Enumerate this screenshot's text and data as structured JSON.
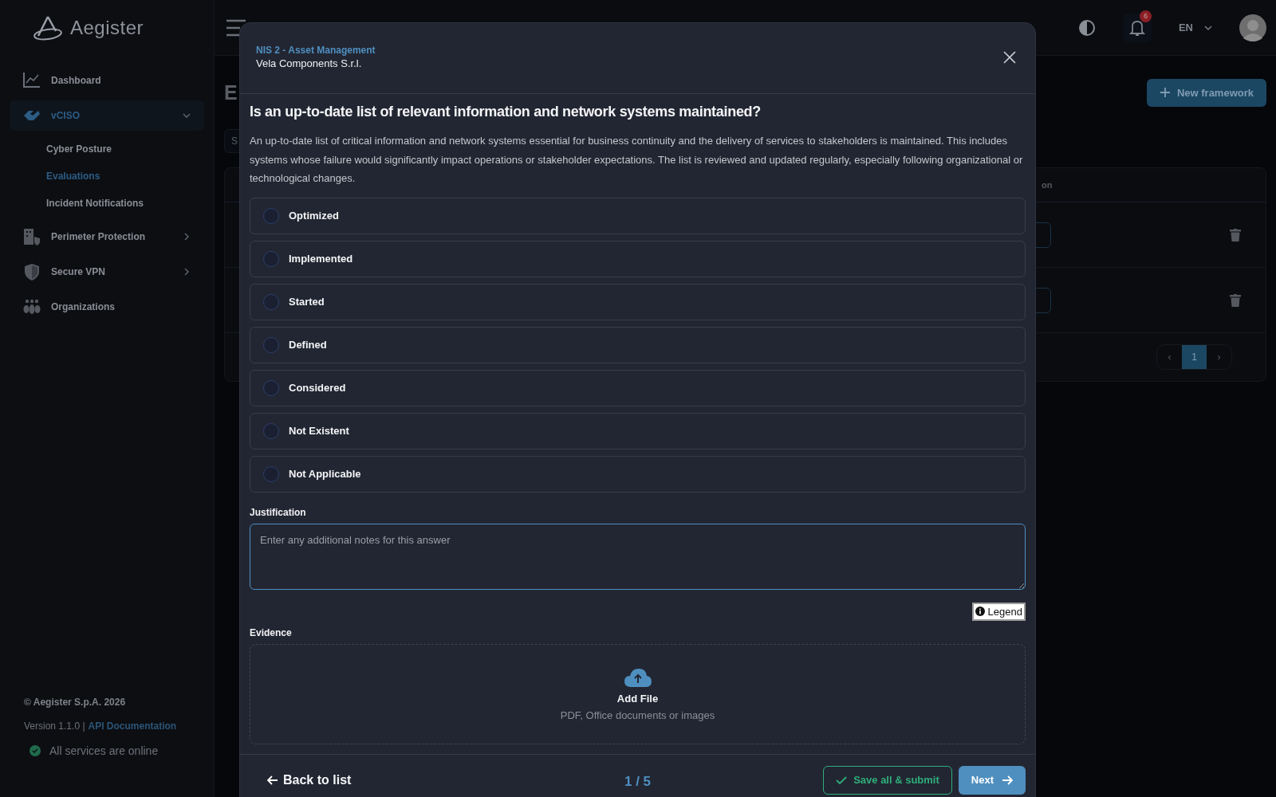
{
  "sidebar": {
    "logo": "Aegister",
    "items": [
      {
        "label": "Dashboard",
        "kind": "link",
        "selected": false
      },
      {
        "label": "vCISO",
        "kind": "group",
        "selected": true,
        "expanded": true,
        "children": [
          {
            "label": "Cyber Posture",
            "selected": false
          },
          {
            "label": "Evaluations",
            "selected": true
          },
          {
            "label": "Incident Notifications",
            "selected": false
          }
        ]
      },
      {
        "label": "Perimeter Protection",
        "kind": "group",
        "selected": false,
        "expanded": false
      },
      {
        "label": "Secure VPN",
        "kind": "group",
        "selected": false,
        "expanded": false
      },
      {
        "label": "Organizations",
        "kind": "link",
        "selected": false
      }
    ],
    "copyright": "© Aegister S.p.A. 2026",
    "version": "Version 1.1.0 |",
    "docs_link": "API Documentation",
    "status": "All services are online"
  },
  "header": {
    "notification_count": "6",
    "language": "EN"
  },
  "page": {
    "title": "E",
    "search_placeholder": "S",
    "column_header": "on",
    "new_button": "New framework",
    "pagination": {
      "prev": "‹",
      "next": "›",
      "pages": [
        {
          "label": "1",
          "selected": true
        }
      ]
    }
  },
  "modal": {
    "framework": "NIS 2 - Asset Management",
    "organization": "Vela Components S.r.l.",
    "question": "Is an up-to-date list of relevant information and network systems maintained?",
    "description": "An up-to-date list of critical information and network systems essential for business continuity and the delivery of services to stakeholders is maintained. This includes systems whose failure would significantly impact operations or stakeholder expectations. The list is reviewed and updated regularly, especially following organizational or technological changes.",
    "options": [
      {
        "label": "Optimized",
        "selected": false
      },
      {
        "label": "Implemented",
        "selected": false
      },
      {
        "label": "Started",
        "selected": false
      },
      {
        "label": "Defined",
        "selected": false
      },
      {
        "label": "Considered",
        "selected": false
      },
      {
        "label": "Not Existent",
        "selected": false
      },
      {
        "label": "Not Applicable",
        "selected": false
      }
    ],
    "justification_label": "Justification",
    "justification": {
      "placeholder": "Enter any additional notes for this answer"
    },
    "legend_button": "Legend",
    "evidence_label": "Evidence",
    "upload_title": "Add File",
    "upload_hint": "PDF, Office documents or images",
    "back_button": "Back to list",
    "progress": "1 / 5",
    "submit_button": "Save all & submit",
    "next_button": "Next"
  }
}
